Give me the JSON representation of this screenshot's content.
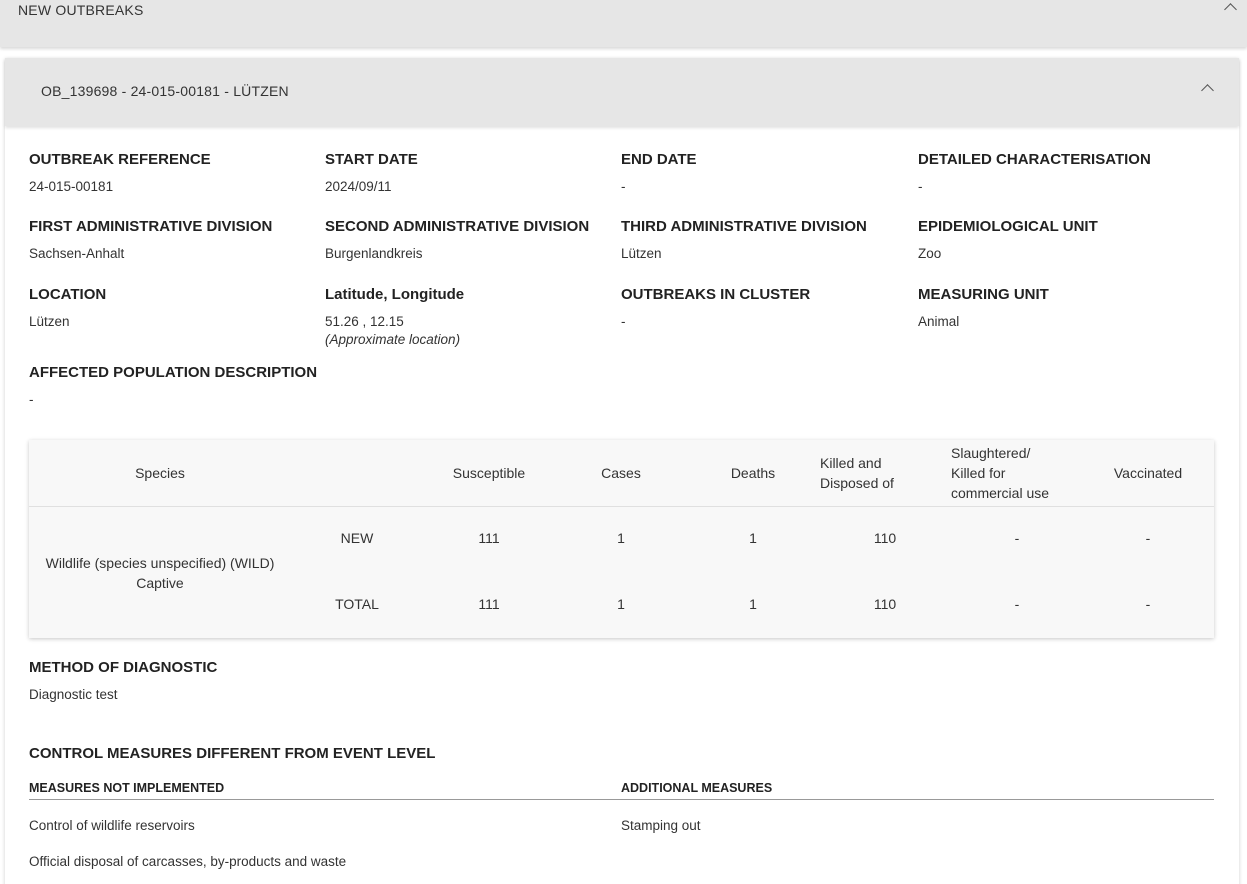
{
  "top_panel": {
    "title": "NEW OUTBREAKS"
  },
  "outbreak": {
    "header": "OB_139698 - 24-015-00181 - LÜTZEN",
    "fields": {
      "outbreak_reference": {
        "label": "OUTBREAK REFERENCE",
        "value": "24-015-00181"
      },
      "start_date": {
        "label": "START DATE",
        "value": "2024/09/11"
      },
      "end_date": {
        "label": "END DATE",
        "value": "-"
      },
      "detailed_characterisation": {
        "label": "DETAILED CHARACTERISATION",
        "value": "-"
      },
      "first_admin": {
        "label": "FIRST ADMINISTRATIVE DIVISION",
        "value": "Sachsen-Anhalt"
      },
      "second_admin": {
        "label": "SECOND ADMINISTRATIVE DIVISION",
        "value": "Burgenlandkreis"
      },
      "third_admin": {
        "label": "THIRD ADMINISTRATIVE DIVISION",
        "value": "Lützen"
      },
      "epi_unit": {
        "label": "EPIDEMIOLOGICAL UNIT",
        "value": "Zoo"
      },
      "location": {
        "label": "LOCATION",
        "value": "Lützen"
      },
      "lat_long": {
        "label": "Latitude, Longitude",
        "value": "51.26 , 12.15",
        "note": "(Approximate location)"
      },
      "outbreaks_in_cluster": {
        "label": "OUTBREAKS IN CLUSTER",
        "value": "-"
      },
      "measuring_unit": {
        "label": "MEASURING UNIT",
        "value": "Animal"
      },
      "affected_population": {
        "label": "AFFECTED POPULATION DESCRIPTION",
        "value": "-"
      }
    },
    "table": {
      "headers": {
        "species": "Species",
        "susceptible": "Susceptible",
        "cases": "Cases",
        "deaths": "Deaths",
        "killed_line1": "Killed and",
        "killed_line2": "Disposed of",
        "slaughtered_line1": "Slaughtered/",
        "slaughtered_line2": "Killed for",
        "slaughtered_line3": "commercial use",
        "vaccinated": "Vaccinated"
      },
      "species_line1": "Wildlife (species unspecified) (WILD)",
      "species_line2": "Captive",
      "rows": [
        {
          "type": "NEW",
          "susceptible": "111",
          "cases": "1",
          "deaths": "1",
          "killed": "110",
          "slaughtered": "-",
          "vaccinated": "-"
        },
        {
          "type": "TOTAL",
          "susceptible": "111",
          "cases": "1",
          "deaths": "1",
          "killed": "110",
          "slaughtered": "-",
          "vaccinated": "-"
        }
      ]
    },
    "diagnostic": {
      "label": "METHOD OF DIAGNOSTIC",
      "value": "Diagnostic test"
    },
    "control_measures": {
      "title": "CONTROL MEASURES DIFFERENT FROM EVENT LEVEL",
      "not_implemented_label": "MEASURES NOT IMPLEMENTED",
      "additional_label": "ADDITIONAL MEASURES",
      "not_implemented": [
        "Control of wildlife reservoirs",
        "Official disposal of carcasses, by-products and waste"
      ],
      "additional": [
        "Stamping out"
      ]
    }
  }
}
